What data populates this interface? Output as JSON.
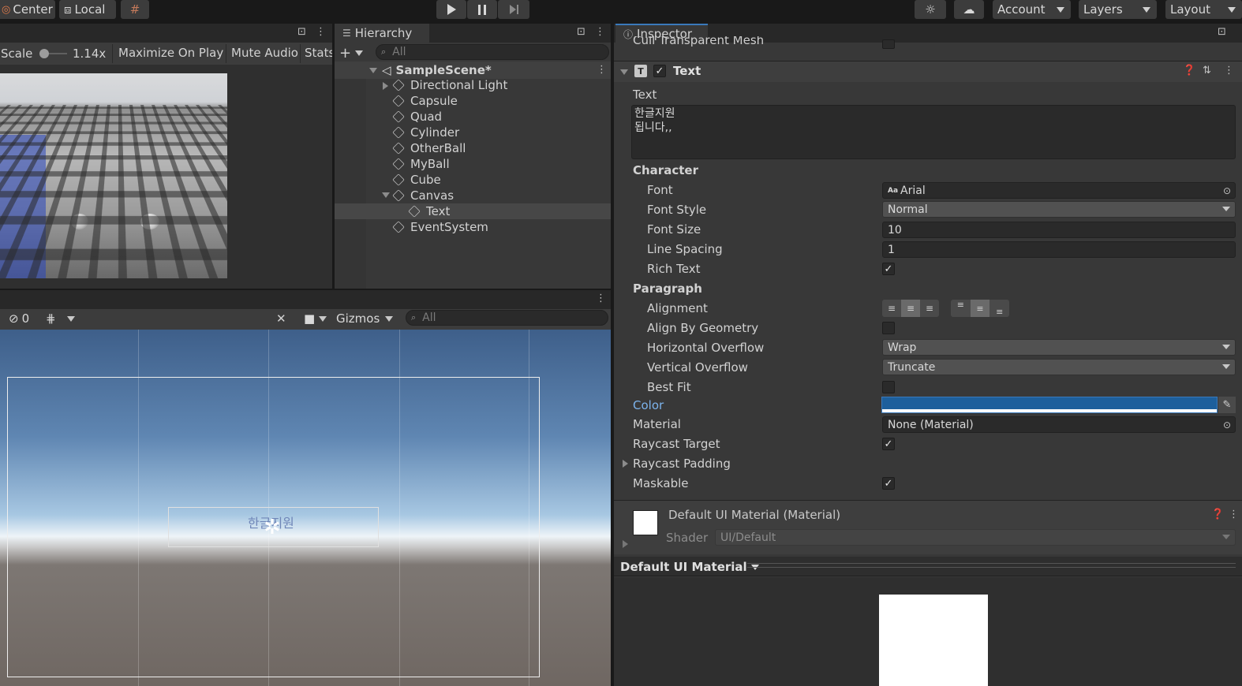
{
  "toolbar": {
    "center": "Center",
    "local": "Local",
    "account": "Account",
    "layers": "Layers",
    "layout": "Layout"
  },
  "game_view": {
    "scale_label": "Scale",
    "scale_value": "1.14x",
    "maximize": "Maximize On Play",
    "mute": "Mute Audio",
    "stats": "Stats"
  },
  "scene_view": {
    "hidden_count": "0",
    "gizmos": "Gizmos",
    "search_placeholder": "All",
    "canvas_text": "한글지원"
  },
  "hierarchy": {
    "tab": "Hierarchy",
    "search_placeholder": "All",
    "scene": "SampleScene*",
    "items": [
      {
        "label": "Directional Light",
        "indent": 1,
        "expander": "right"
      },
      {
        "label": "Capsule",
        "indent": 1,
        "expander": ""
      },
      {
        "label": "Quad",
        "indent": 1,
        "expander": ""
      },
      {
        "label": "Cylinder",
        "indent": 1,
        "expander": ""
      },
      {
        "label": "OtherBall",
        "indent": 1,
        "expander": ""
      },
      {
        "label": "MyBall",
        "indent": 1,
        "expander": ""
      },
      {
        "label": "Cube",
        "indent": 1,
        "expander": ""
      },
      {
        "label": "Canvas",
        "indent": 1,
        "expander": "down"
      },
      {
        "label": "Text",
        "indent": 2,
        "expander": "",
        "selected": true
      },
      {
        "label": "EventSystem",
        "indent": 1,
        "expander": ""
      }
    ]
  },
  "inspector": {
    "tab": "Inspector",
    "cut_row": "Cull Transparent Mesh",
    "component": "Text",
    "text_label": "Text",
    "text_value_line1": "한글지원",
    "text_value_line2": "됩니다,,",
    "character_header": "Character",
    "font_label": "Font",
    "font_value": "Arial",
    "font_style_label": "Font Style",
    "font_style_value": "Normal",
    "font_size_label": "Font Size",
    "font_size_value": "10",
    "line_spacing_label": "Line Spacing",
    "line_spacing_value": "1",
    "rich_text_label": "Rich Text",
    "paragraph_header": "Paragraph",
    "alignment_label": "Alignment",
    "align_geometry_label": "Align By Geometry",
    "h_overflow_label": "Horizontal Overflow",
    "h_overflow_value": "Wrap",
    "v_overflow_label": "Vertical Overflow",
    "v_overflow_value": "Truncate",
    "best_fit_label": "Best Fit",
    "color_label": "Color",
    "color_value": "#1d5f9c",
    "material_label": "Material",
    "material_value": "None (Material)",
    "raycast_target_label": "Raycast Target",
    "raycast_padding_label": "Raycast Padding",
    "maskable_label": "Maskable",
    "material_title": "Default UI Material (Material)",
    "shader_label": "Shader",
    "shader_value": "UI/Default",
    "preview_dropdown": "Default UI Material"
  }
}
